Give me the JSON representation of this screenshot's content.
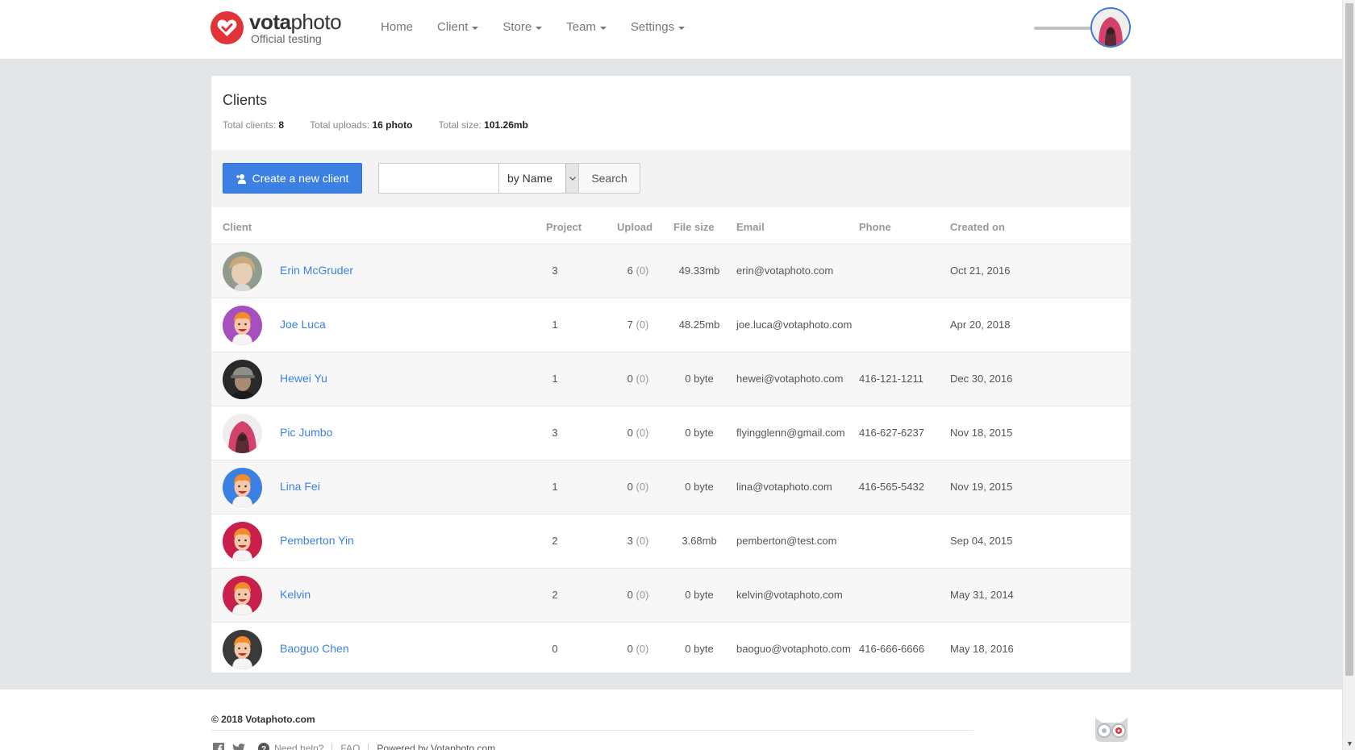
{
  "brand": {
    "name_bold": "vota",
    "name_rest": "photo",
    "subtitle": "Official testing"
  },
  "nav": {
    "home": "Home",
    "client": "Client",
    "store": "Store",
    "team": "Team",
    "settings": "Settings"
  },
  "page": {
    "title": "Clients",
    "stats": {
      "clients_label": "Total clients:",
      "clients_value": "8",
      "uploads_label": "Total uploads:",
      "uploads_value": "16 photo",
      "size_label": "Total size:",
      "size_value": "101.26mb"
    }
  },
  "toolbar": {
    "create_label": "Create a new client",
    "search_value": "",
    "filter_selected": "by Name",
    "search_label": "Search"
  },
  "table": {
    "headers": {
      "client": "Client",
      "project": "Project",
      "upload": "Upload",
      "file_size": "File size",
      "email": "Email",
      "phone": "Phone",
      "created": "Created on"
    },
    "rows": [
      {
        "name": "Erin McGruder",
        "project": "3",
        "upload": "6",
        "pending": "(0)",
        "size": "49.33mb",
        "email": "erin@votaphoto.com",
        "phone": "",
        "created": "Oct 21, 2016",
        "avatar": "photo-portrait",
        "color": "#9aa59a"
      },
      {
        "name": "Joe Luca",
        "project": "1",
        "upload": "7",
        "pending": "(0)",
        "size": "48.25mb",
        "email": "joe.luca@votaphoto.com",
        "phone": "",
        "created": "Apr 20, 2018",
        "avatar": "cartoon-face",
        "color": "#a64fbf"
      },
      {
        "name": "Hewei Yu",
        "project": "1",
        "upload": "0",
        "pending": "(0)",
        "size": "0 byte",
        "email": "hewei@votaphoto.com",
        "phone": "416-121-1211",
        "created": "Dec 30, 2016",
        "avatar": "photo-cap",
        "color": "#2a2a2a"
      },
      {
        "name": "Pic Jumbo",
        "project": "3",
        "upload": "0",
        "pending": "(0)",
        "size": "0 byte",
        "email": "flyingglenn@gmail.com",
        "phone": "416-627-6237",
        "created": "Nov 18, 2015",
        "avatar": "photo-hood",
        "color": "#f1eded"
      },
      {
        "name": "Lina Fei",
        "project": "1",
        "upload": "0",
        "pending": "(0)",
        "size": "0 byte",
        "email": "lina@votaphoto.com",
        "phone": "416-565-5432",
        "created": "Nov 19, 2015",
        "avatar": "cartoon-face",
        "color": "#3d80e4"
      },
      {
        "name": "Pemberton Yin",
        "project": "2",
        "upload": "3",
        "pending": "(0)",
        "size": "3.68mb",
        "email": "pemberton@test.com",
        "phone": "",
        "created": "Sep 04, 2015",
        "avatar": "cartoon-face",
        "color": "#c8204a"
      },
      {
        "name": "Kelvin",
        "project": "2",
        "upload": "0",
        "pending": "(0)",
        "size": "0 byte",
        "email": "kelvin@votaphoto.com",
        "phone": "",
        "created": "May 31, 2014",
        "avatar": "cartoon-face",
        "color": "#c8204a"
      },
      {
        "name": "Baoguo Chen",
        "project": "0",
        "upload": "0",
        "pending": "(0)",
        "size": "0 byte",
        "email": "baoguo@votaphoto.com",
        "phone": "416-666-6666",
        "created": "May 18, 2016",
        "avatar": "cartoon-face",
        "color": "#3a3a3a"
      }
    ]
  },
  "footer": {
    "copyright": "© 2018 Votaphoto.com",
    "help": "Need help?",
    "faq": "FAQ",
    "powered_prefix": "Powered by",
    "powered_name": "Votaphoto.com"
  },
  "colors": {
    "accent": "#3d80e4",
    "brand_red": "#e2333b"
  }
}
